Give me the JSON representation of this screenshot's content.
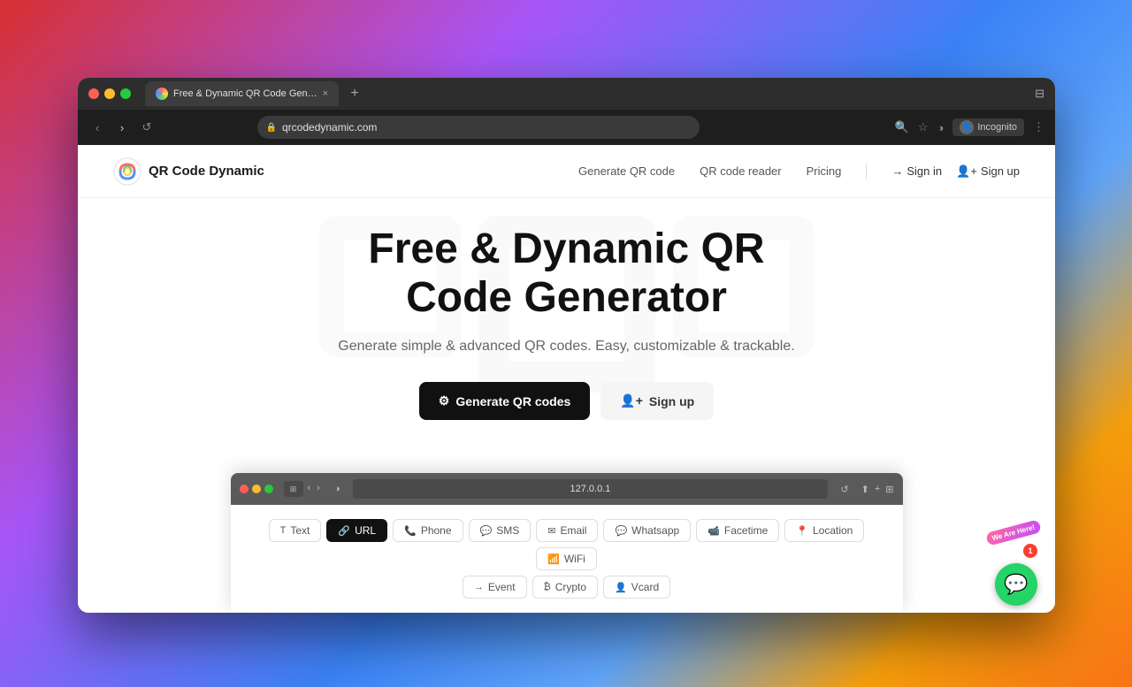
{
  "desktop": {
    "bg_note": "gradient desktop background"
  },
  "browser": {
    "tab": {
      "favicon_alt": "QR Code Dynamic favicon",
      "title": "Free & Dynamic QR Code Gen…",
      "close_label": "×"
    },
    "new_tab_label": "+",
    "address": {
      "url": "qrcodedynamic.com",
      "lock_icon": "🔒"
    },
    "controls": {
      "back": "‹",
      "forward": "›",
      "reload": "↺",
      "zoom": "🔍",
      "bookmark": "☆",
      "theme": "◑",
      "profile_label": "Incognito",
      "menu": "⋮"
    }
  },
  "site": {
    "logo_text": "QR Code Dynamic",
    "nav": {
      "generate_qr": "Generate QR code",
      "qr_reader": "QR code reader",
      "pricing": "Pricing",
      "signin_icon": "→",
      "signin_label": "Sign in",
      "signup_icon": "👤",
      "signup_label": "Sign up"
    },
    "hero": {
      "title": "Free & Dynamic QR Code Generator",
      "subtitle": "Generate simple & advanced QR codes. Easy, customizable & trackable.",
      "btn_generate_icon": "⚙",
      "btn_generate_label": "Generate QR codes",
      "btn_signup_icon": "👤",
      "btn_signup_label": "Sign up"
    }
  },
  "inner_browser": {
    "address": "127.0.0.1",
    "tabs": {
      "row1": [
        {
          "icon": "T",
          "label": "Text",
          "active": false
        },
        {
          "icon": "🔗",
          "label": "URL",
          "active": true
        },
        {
          "icon": "📞",
          "label": "Phone",
          "active": false
        },
        {
          "icon": "💬",
          "label": "SMS",
          "active": false
        },
        {
          "icon": "✉",
          "label": "Email",
          "active": false
        },
        {
          "icon": "💬",
          "label": "Whatsapp",
          "active": false
        },
        {
          "icon": "📹",
          "label": "Facetime",
          "active": false
        },
        {
          "icon": "📍",
          "label": "Location",
          "active": false
        },
        {
          "icon": "📶",
          "label": "WiFi",
          "active": false
        }
      ],
      "row2": [
        {
          "icon": "→",
          "label": "Event",
          "active": false
        },
        {
          "icon": "₿",
          "label": "Crypto",
          "active": false
        },
        {
          "icon": "👤",
          "label": "Vcard",
          "active": false
        }
      ]
    }
  },
  "chat_widget": {
    "label": "We Are Here!",
    "notification_count": "1",
    "icon": "💬"
  }
}
